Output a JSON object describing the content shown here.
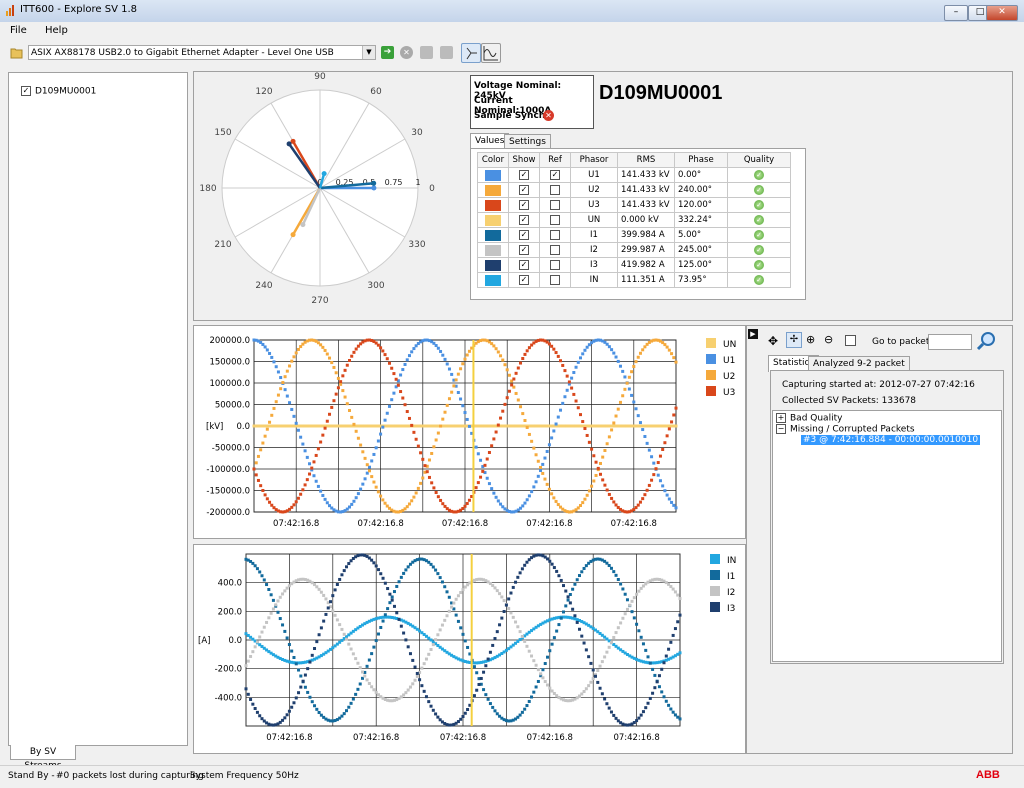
{
  "window": {
    "title": "ITT600 - Explore SV 1.8"
  },
  "menu": {
    "file": "File",
    "help": "Help"
  },
  "toolbar": {
    "adapter": "ASIX AX88178 USB2.0 to Gigabit Ethernet Adapter - Level One USB"
  },
  "streams": {
    "items": [
      {
        "label": "D109MU0001",
        "checked": true
      }
    ],
    "tab": "By SV Streams"
  },
  "info": {
    "voltage": "Voltage Nominal: 245kV",
    "current": "Current Nominal:1000A",
    "sync": "Sample Synch:",
    "device": "D109MU0001"
  },
  "phasor_tabs": {
    "values": "Values",
    "settings": "Settings"
  },
  "polar": {
    "angle_labels": [
      "0",
      "30",
      "60",
      "90",
      "120",
      "150",
      "180",
      "210",
      "240",
      "270",
      "300",
      "330"
    ],
    "radius_labels": [
      "0",
      "0.25",
      "0.5",
      "0.75",
      "1"
    ]
  },
  "table": {
    "headers": [
      "Color",
      "Show",
      "Ref",
      "Phasor",
      "RMS",
      "Phase",
      "Quality"
    ],
    "rows": [
      {
        "color": "#4a90e2",
        "show": true,
        "ref": true,
        "phasor": "U1",
        "rms": "141.433 kV",
        "phase": "0.00°",
        "quality": "ok"
      },
      {
        "color": "#f5a93b",
        "show": true,
        "ref": false,
        "phasor": "U2",
        "rms": "141.433 kV",
        "phase": "240.00°",
        "quality": "ok"
      },
      {
        "color": "#d9471b",
        "show": true,
        "ref": false,
        "phasor": "U3",
        "rms": "141.433 kV",
        "phase": "120.00°",
        "quality": "ok"
      },
      {
        "color": "#f7d070",
        "show": true,
        "ref": false,
        "phasor": "UN",
        "rms": "0.000 kV",
        "phase": "332.24°",
        "quality": "ok"
      },
      {
        "color": "#126a9c",
        "show": true,
        "ref": false,
        "phasor": "I1",
        "rms": "399.984 A",
        "phase": "5.00°",
        "quality": "ok"
      },
      {
        "color": "#c4c4c4",
        "show": true,
        "ref": false,
        "phasor": "I2",
        "rms": "299.987 A",
        "phase": "245.00°",
        "quality": "ok"
      },
      {
        "color": "#1f3f6e",
        "show": true,
        "ref": false,
        "phasor": "I3",
        "rms": "419.982 A",
        "phase": "125.00°",
        "quality": "ok"
      },
      {
        "color": "#22a7e0",
        "show": true,
        "ref": false,
        "phasor": "IN",
        "rms": "111.351 A",
        "phase": "73.95°",
        "quality": "ok"
      }
    ]
  },
  "chart_data": [
    {
      "type": "line",
      "ylabel": "[kV]",
      "ylim": [
        -200000,
        200000
      ],
      "y_ticks": [
        "200000.0",
        "150000.0",
        "100000.0",
        "50000.0",
        "0.0",
        "-50000.0",
        "-100000.0",
        "-150000.0",
        "-200000.0"
      ],
      "x_ticks": [
        "07:42:16.8",
        "07:42:16.8",
        "07:42:16.8",
        "07:42:16.8",
        "07:42:16.8"
      ],
      "series": [
        {
          "name": "UN",
          "color": "#f7d070",
          "amplitude": 0,
          "phase_deg": 0
        },
        {
          "name": "U1",
          "color": "#4a90e2",
          "amplitude": 200000,
          "phase_deg": 0
        },
        {
          "name": "U2",
          "color": "#f5a93b",
          "amplitude": 200000,
          "phase_deg": 240
        },
        {
          "name": "U3",
          "color": "#d9471b",
          "amplitude": 200000,
          "phase_deg": 120
        }
      ]
    },
    {
      "type": "line",
      "ylabel": "[A]",
      "ylim": [
        -600,
        600
      ],
      "y_ticks": [
        "400.0",
        "200.0",
        "0.0",
        "-200.0",
        "-400.0"
      ],
      "x_ticks": [
        "07:42:16.8",
        "07:42:16.8",
        "07:42:16.8",
        "07:42:16.8",
        "07:42:16.8"
      ],
      "series": [
        {
          "name": "IN",
          "color": "#22a7e0",
          "amplitude": 160,
          "phase_deg": 74
        },
        {
          "name": "I1",
          "color": "#126a9c",
          "amplitude": 565,
          "phase_deg": 5
        },
        {
          "name": "I2",
          "color": "#c4c4c4",
          "amplitude": 424,
          "phase_deg": 245
        },
        {
          "name": "I3",
          "color": "#1f3f6e",
          "amplitude": 594,
          "phase_deg": 125
        }
      ]
    }
  ],
  "side": {
    "goto_label": "Go to packet :",
    "tab_stats": "Statistics",
    "tab_analyzed": "Analyzed 9-2 packet",
    "capture_started": "Capturing started at: 2012-07-27 07:42:16",
    "collected": "Collected SV Packets: 133678",
    "tree": {
      "bad": "Bad Quality",
      "missing": "Missing / Corrupted Packets",
      "entry": "#3 @ 7:42:16.884 - 00:00:00.0010010"
    }
  },
  "status": {
    "mode": "Stand By -",
    "lost": "#0 packets lost during capturing",
    "freq": "System Frequency 50Hz",
    "brand": "ABB"
  }
}
